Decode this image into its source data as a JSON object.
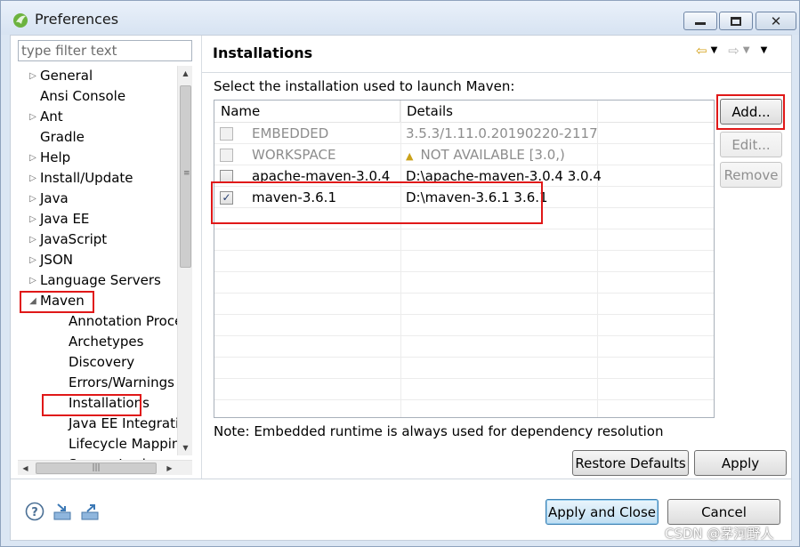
{
  "window": {
    "title": "Preferences"
  },
  "filter": {
    "placeholder": "type filter text"
  },
  "tree": {
    "items": [
      {
        "label": "General",
        "expander": "▷"
      },
      {
        "label": "Ansi Console",
        "expander": ""
      },
      {
        "label": "Ant",
        "expander": "▷"
      },
      {
        "label": "Gradle",
        "expander": ""
      },
      {
        "label": "Help",
        "expander": "▷"
      },
      {
        "label": "Install/Update",
        "expander": "▷"
      },
      {
        "label": "Java",
        "expander": "▷"
      },
      {
        "label": "Java EE",
        "expander": "▷"
      },
      {
        "label": "JavaScript",
        "expander": "▷"
      },
      {
        "label": "JSON",
        "expander": "▷"
      },
      {
        "label": "Language Servers",
        "expander": "▷"
      },
      {
        "label": "Maven",
        "expander": "◢"
      },
      {
        "label": "Annotation Proces",
        "expander": ""
      },
      {
        "label": "Archetypes",
        "expander": ""
      },
      {
        "label": "Discovery",
        "expander": ""
      },
      {
        "label": "Errors/Warnings",
        "expander": ""
      },
      {
        "label": "Installations",
        "expander": ""
      },
      {
        "label": "Java EE Integration",
        "expander": ""
      },
      {
        "label": "Lifecycle Mapping",
        "expander": ""
      },
      {
        "label": "Source Lookup",
        "expander": ""
      }
    ]
  },
  "page": {
    "title": "Installations",
    "description": "Select the installation used to launch Maven:",
    "note": "Note: Embedded runtime is always used for dependency resolution"
  },
  "table": {
    "columns": [
      "Name",
      "Details"
    ],
    "rows": [
      {
        "name": "EMBEDDED",
        "details": "3.5.3/1.11.0.20190220-2117",
        "checked": false,
        "enabled": false,
        "warning": false
      },
      {
        "name": "WORKSPACE",
        "details": "NOT AVAILABLE [3.0,)",
        "checked": false,
        "enabled": false,
        "warning": true
      },
      {
        "name": "apache-maven-3.0.4",
        "details": "D:\\apache-maven-3.0.4 3.0.4",
        "checked": false,
        "enabled": true,
        "warning": false
      },
      {
        "name": "maven-3.6.1",
        "details": "D:\\maven-3.6.1 3.6.1",
        "checked": true,
        "enabled": true,
        "warning": false
      }
    ]
  },
  "buttons": {
    "add": "Add...",
    "edit": "Edit...",
    "remove": "Remove",
    "restore_defaults": "Restore Defaults",
    "apply": "Apply",
    "apply_and_close": "Apply and Close",
    "cancel": "Cancel"
  },
  "icons": {
    "help": "help-icon",
    "import": "import-icon",
    "export": "export-icon",
    "back": "back-arrow-icon",
    "forward": "forward-arrow-icon"
  },
  "colors": {
    "highlight_box": "#e01818",
    "default_button": "#bfdef2"
  },
  "watermark": "CSDN @茅河野人"
}
